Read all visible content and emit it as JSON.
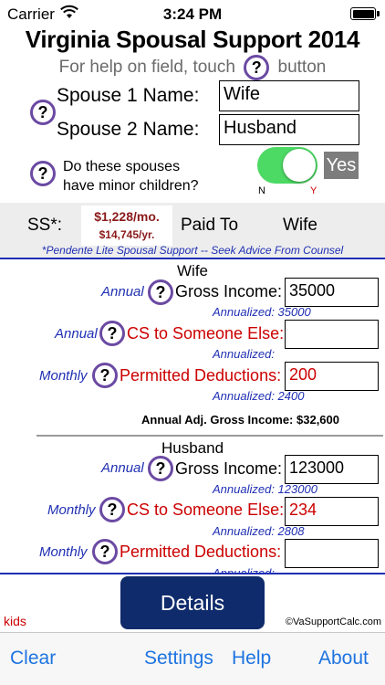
{
  "status_bar": {
    "carrier": "Carrier",
    "time": "3:24 PM"
  },
  "header": {
    "title": "Virginia Spousal Support 2014",
    "help_prefix": "For help on field, touch",
    "help_suffix": "button",
    "help_glyph": "?"
  },
  "names": {
    "spouse1_label": "Spouse 1 Name:",
    "spouse1_value": "Wife",
    "spouse2_label": "Spouse 2 Name:",
    "spouse2_value": "Husband"
  },
  "children": {
    "question_line1": "Do these spouses",
    "question_line2": "have minor children?",
    "toggle_on": true,
    "yes_label": "Yes",
    "n_label": "N",
    "y_label": "Y"
  },
  "support": {
    "ss_label": "SS*:",
    "monthly": "$1,228/mo.",
    "yearly": "$14,745/yr.",
    "paid_to_label": "Paid To",
    "paid_to": "Wife",
    "note": "*Pendente Lite Spousal Support -- Seek Advice From Counsel"
  },
  "wife": {
    "heading": "Wife",
    "gross_freq": "Annual",
    "gross_label": "Gross Income:",
    "gross_value": "35000",
    "gross_annualized": "Annualized: 35000",
    "cs_freq": "Annual",
    "cs_label": "CS to Someone Else:",
    "cs_value": "",
    "cs_annualized": "Annualized:",
    "ded_freq": "Monthly",
    "ded_label": "Permitted Deductions:",
    "ded_value": "200",
    "ded_annualized": "Annualized: 2400",
    "agi_label": "Annual Adj. Gross Income: $32,600"
  },
  "husband": {
    "heading": "Husband",
    "gross_freq": "Annual",
    "gross_label": "Gross Income:",
    "gross_value": "123000",
    "gross_annualized": "Annualized: 123000",
    "cs_freq": "Monthly",
    "cs_label": "CS to Someone Else:",
    "cs_value": "234",
    "cs_annualized": "Annualized: 2808",
    "ded_freq": "Monthly",
    "ded_label": "Permitted Deductions:",
    "ded_value": "",
    "ded_annualized": "Annualized:"
  },
  "footer": {
    "details_label": "Details",
    "kids_label": "kids",
    "copyright": "©VaSupportCalc.com"
  },
  "tabbar": {
    "clear": "Clear",
    "settings": "Settings",
    "help": "Help",
    "about": "About"
  },
  "colors": {
    "accent_blue": "#1f2fb3",
    "tab_blue": "#1e74e0",
    "toggle_green": "#4cd964",
    "red": "#cc0000",
    "button_navy": "#0f2b6b",
    "help_ring": "#6b4aa3"
  }
}
